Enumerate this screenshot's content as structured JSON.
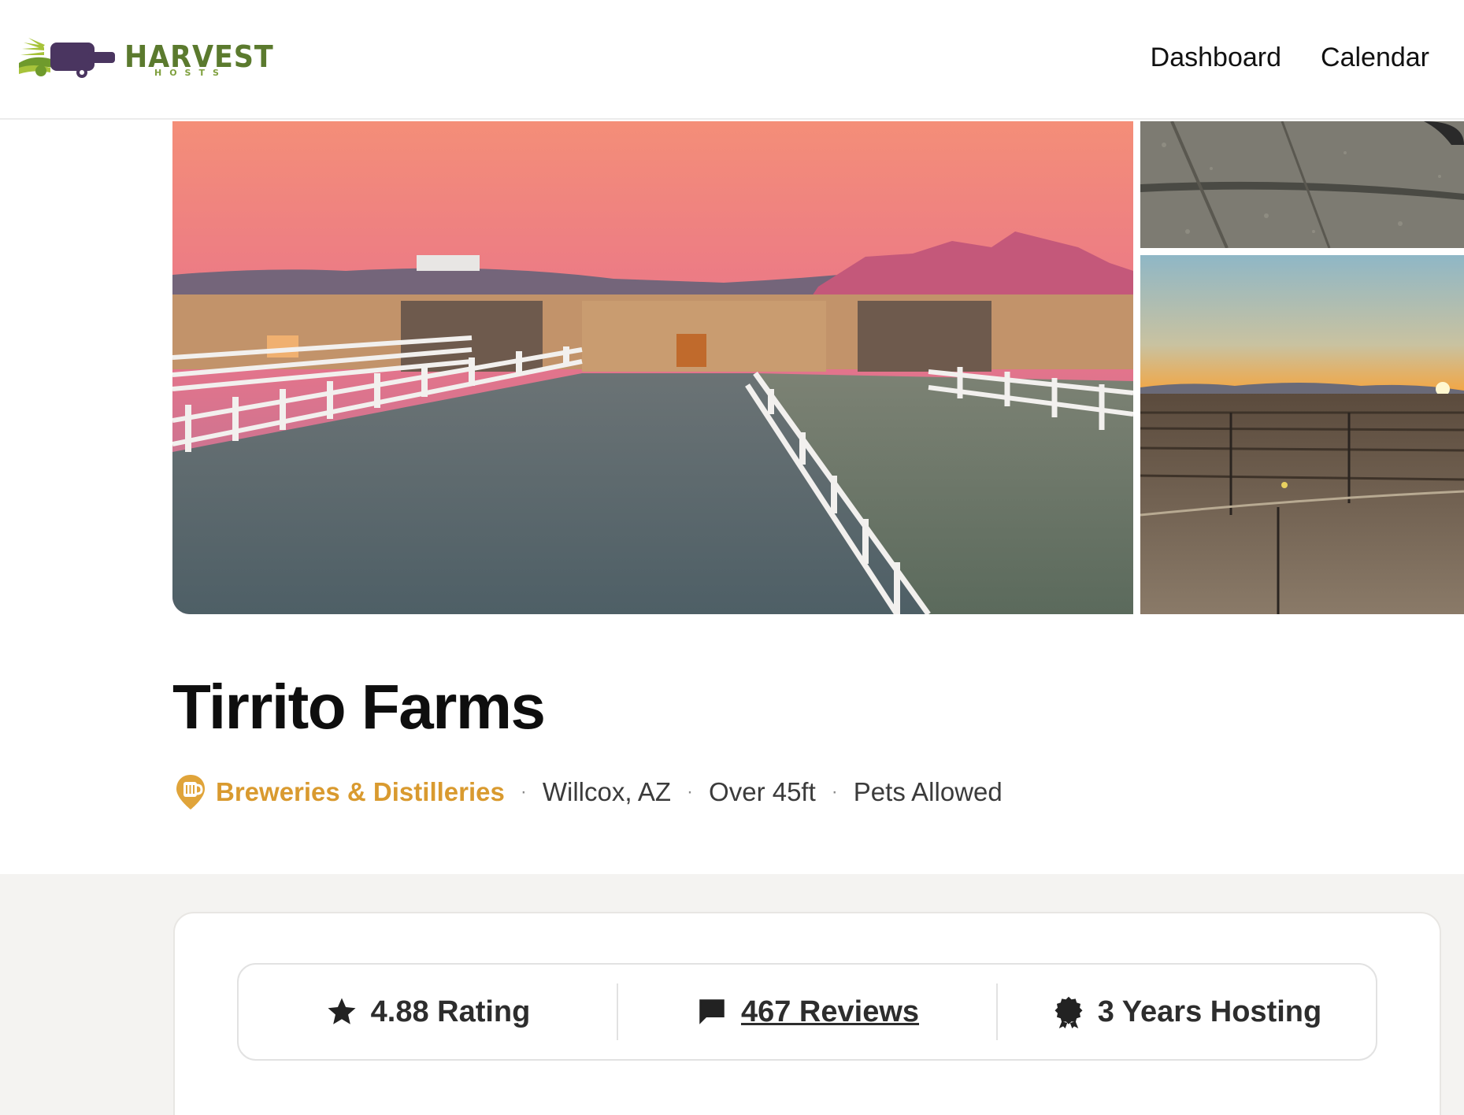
{
  "header": {
    "logo_text": "HARVEST",
    "logo_subtext": "HOSTS",
    "nav": [
      {
        "label": "Dashboard"
      },
      {
        "label": "Calendar"
      }
    ]
  },
  "listing": {
    "title": "Tirrito Farms",
    "category": "Breweries & Distilleries",
    "location": "Willcox, AZ",
    "size_limit": "Over 45ft",
    "pets": "Pets Allowed",
    "separator": "·"
  },
  "stats": {
    "rating_label": "4.88 Rating",
    "reviews_label": "467 Reviews",
    "hosting_label": "3 Years Hosting",
    "icons": [
      "star-icon",
      "chat-bubble-icon",
      "badge-icon"
    ]
  },
  "colors": {
    "brand_green": "#5b7a2e",
    "category_gold": "#d99a2f",
    "lower_bg": "#f4f3f1"
  }
}
